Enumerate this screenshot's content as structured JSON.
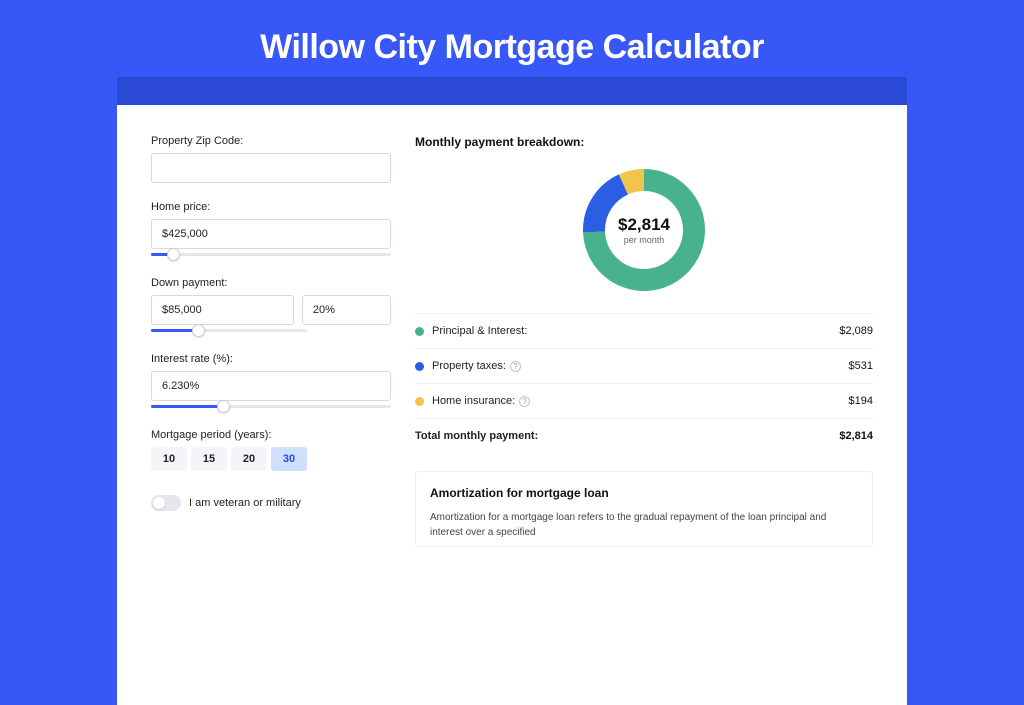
{
  "hero": {
    "title": "Willow City Mortgage Calculator"
  },
  "form": {
    "zip_label": "Property Zip Code:",
    "zip_value": "",
    "home_price_label": "Home price:",
    "home_price_value": "$425,000",
    "down_payment_label": "Down payment:",
    "down_payment_value": "$85,000",
    "down_payment_pct": "20%",
    "interest_label": "Interest rate (%):",
    "interest_value": "6.230%",
    "period_label": "Mortgage period (years):",
    "periods": [
      "10",
      "15",
      "20",
      "30"
    ],
    "period_selected": "30",
    "veteran_label": "I am veteran or military"
  },
  "breakdown": {
    "title": "Monthly payment breakdown:",
    "donut_amount": "$2,814",
    "donut_sub": "per month",
    "items": [
      {
        "label": "Principal & Interest:",
        "value": "$2,089",
        "color": "#47b28b"
      },
      {
        "label": "Property taxes:",
        "value": "$531",
        "color": "#2b5fe3",
        "info": true
      },
      {
        "label": "Home insurance:",
        "value": "$194",
        "color": "#f1c44a",
        "info": true
      }
    ],
    "total_label": "Total monthly payment:",
    "total_value": "$2,814"
  },
  "amort": {
    "title": "Amortization for mortgage loan",
    "text": "Amortization for a mortgage loan refers to the gradual repayment of the loan principal and interest over a specified"
  },
  "chart_data": {
    "type": "pie",
    "title": "Monthly payment breakdown",
    "series": [
      {
        "name": "Principal & Interest",
        "value": 2089,
        "color": "#47b28b"
      },
      {
        "name": "Property taxes",
        "value": 531,
        "color": "#2b5fe3"
      },
      {
        "name": "Home insurance",
        "value": 194,
        "color": "#f1c44a"
      }
    ],
    "total": 2814,
    "center_label": "$2,814 per month"
  }
}
